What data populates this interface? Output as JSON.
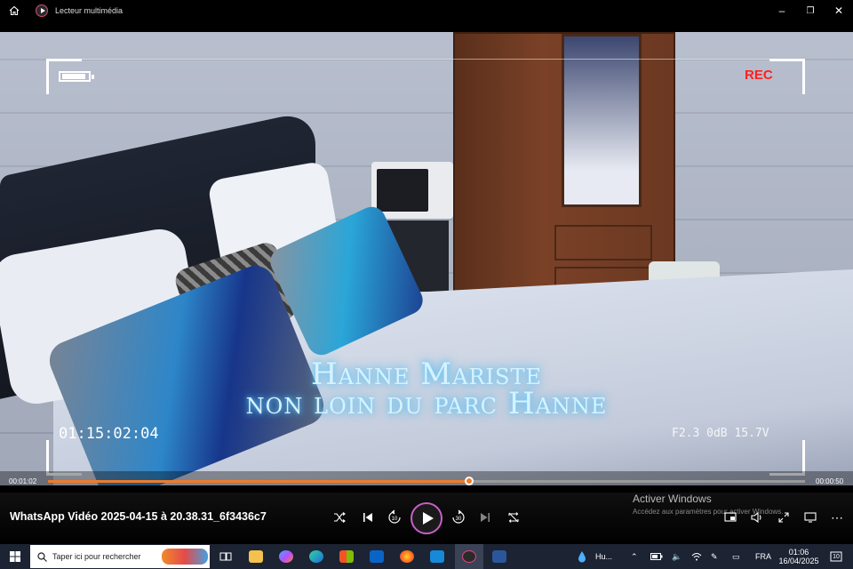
{
  "titlebar": {
    "app_title": "Lecteur multimédia",
    "home_icon": "home-icon",
    "minimize": "–",
    "restore": "❐",
    "close": "✕"
  },
  "overlay": {
    "battery_icon": "battery-icon",
    "rec_label": "REC",
    "timecode": "01:15:02:04",
    "camera_stats": "F2.3  0dB  15.7V",
    "caption_line1": "Hanne Mariste",
    "caption_line2": "non loin du parc Hanne"
  },
  "playback": {
    "current_time": "00:01:02",
    "total_time": "00:00:50",
    "progress_fraction": 0.556
  },
  "controls": {
    "video_title": "WhatsApp Vidéo 2025-04-15 à 20.38.31_6f3436c7",
    "shuffle_icon": "shuffle-icon",
    "previous_icon": "previous-icon",
    "rewind_label": "10",
    "play_icon": "play-icon",
    "forward_label": "30",
    "next_icon": "next-icon",
    "repeat_icon": "repeat-icon",
    "miniplayer_icon": "miniplayer-icon",
    "volume_icon": "volume-icon",
    "fullscreen_icon": "fullscreen-icon",
    "cast_icon": "cast-icon",
    "more_label": "⋯"
  },
  "activation": {
    "line1": "Activer Windows",
    "line2": "Accédez aux paramètres pour activer Windows."
  },
  "taskbar": {
    "search_placeholder": "Taper ici pour rechercher",
    "weather_label": "Hu...",
    "language": "FRA",
    "time": "01:06",
    "date": "16/04/2025",
    "notification_count": "10",
    "colors": {
      "background": "#1c2333",
      "accent": "#f07b2a",
      "play_ring": "#c660c8"
    }
  }
}
